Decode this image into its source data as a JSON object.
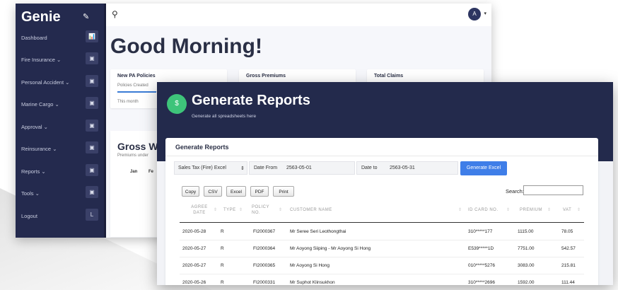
{
  "app": {
    "logo": "Genie",
    "pin": "✎"
  },
  "sidebar": {
    "items": [
      {
        "label": "Dashboard",
        "icon": "chart-icon",
        "glyph": "📊"
      },
      {
        "label": "Fire Insurance ⌄",
        "icon": "box-icon",
        "glyph": "▣"
      },
      {
        "label": "Personal Accident ⌄",
        "icon": "box-icon",
        "glyph": "▣"
      },
      {
        "label": "Marine Cargo ⌄",
        "icon": "box-icon",
        "glyph": "▣"
      },
      {
        "label": "Approval ⌄",
        "icon": "box-icon",
        "glyph": "▣"
      },
      {
        "label": "Reinsurance ⌄",
        "icon": "box-icon",
        "glyph": "▣"
      },
      {
        "label": "Reports ⌄",
        "icon": "box-icon",
        "glyph": "▣"
      },
      {
        "label": "Tools ⌄",
        "icon": "box-icon",
        "glyph": "▣"
      },
      {
        "label": "Logout",
        "icon": "logout-icon",
        "glyph": "L"
      }
    ]
  },
  "topbar": {
    "avatar": "A"
  },
  "dashboard": {
    "greeting": "Good Morning!",
    "cards": [
      {
        "title": "New PA Policies",
        "sub": "Policies Created",
        "meta": "This month"
      },
      {
        "title": "Gross Premiums",
        "sub": "",
        "meta": ""
      },
      {
        "title": "Total Claims",
        "sub": "",
        "meta": ""
      }
    ],
    "gross": {
      "title": "Gross Wi",
      "sub": "Premiums under",
      "col1": "Jan",
      "col2": "Fe"
    }
  },
  "reports": {
    "hero_icon": "$",
    "title": "Generate Reports",
    "subtitle": "Generate all spreadsheets here",
    "panel_title": "Generate Reports",
    "report_select": "Sales Tax (Fire) Excel",
    "date_from_label": "Date From",
    "date_from": "2563-05-01",
    "date_to_label": "Date to",
    "date_to": "2563-05-31",
    "generate_label": "Generate Excel",
    "toolbar": [
      "Copy",
      "CSV",
      "Excel",
      "PDF",
      "Print"
    ],
    "search_label": "Search:",
    "columns": [
      "AGREE DATE",
      "TYPE",
      "POLICY NO.",
      "CUSTOMER NAME",
      "ID CARD NO.",
      "PREMIUM",
      "VAT"
    ],
    "rows": [
      [
        "2020-05-28",
        "R",
        "FI2000367",
        "Mr Seree Seri Leothongthai",
        "310*****177",
        "1115.00",
        "78.05"
      ],
      [
        "2020-05-27",
        "R",
        "FI2000364",
        "Mr Aoyong Siiping - Mr Aoyong Si Hong",
        "E539*****1D",
        "7751.00",
        "542.57"
      ],
      [
        "2020-05-27",
        "R",
        "FI2000365",
        "Mr Aoyong Si Hong",
        "010*****5276",
        "3083.00",
        "215.81"
      ],
      [
        "2020-05-26",
        "R",
        "FI2000331",
        "Mr Suphot Klinsukhon",
        "310*****2696",
        "1592.00",
        "111.44"
      ]
    ]
  },
  "colors": {
    "navy": "#232a4c",
    "accent": "#3f7ee8",
    "green": "#3ec47a"
  }
}
